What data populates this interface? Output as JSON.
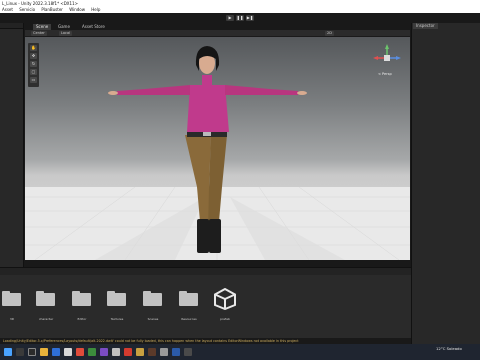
{
  "window": {
    "title": "L_Linux - Unity 2022.3.18f1* <DX11>"
  },
  "menu": [
    {
      "label": "Asset"
    },
    {
      "label": "Servicio"
    },
    {
      "label": "PlanBuster"
    },
    {
      "label": "Window"
    },
    {
      "label": "Help"
    }
  ],
  "play_controls": {
    "play": "▶",
    "pause": "❚❚",
    "step": "▶❚"
  },
  "scene_tabs": [
    {
      "label": "Scene"
    },
    {
      "label": "Game"
    },
    {
      "label": "Asset Store"
    }
  ],
  "scene_toolbar": {
    "shading": "Center",
    "space": "Local",
    "mode": "2D"
  },
  "gizmo": {
    "label": "< Persp"
  },
  "inspector": {
    "label": "Inspector"
  },
  "assets": [
    {
      "name": "3D"
    },
    {
      "name": "character"
    },
    {
      "name": "Editor"
    },
    {
      "name": "Textures"
    },
    {
      "name": "Scenes"
    },
    {
      "name": "Resources"
    },
    {
      "name": "prefab"
    }
  ],
  "status": {
    "message": "Loading/Unity/Editor-5.x/Preferences/Layouts/default/alt-2022.dwlt' could not be fully loaded, this can happen when the layout contains EditorWindows not available in this project"
  },
  "taskbar": {
    "tray": "12°C  Soleado"
  },
  "colors": {
    "scene_sky_top": "#55585b",
    "floor": "#e9e9e9",
    "shirt": "#c03a8c",
    "pants": "#8a6a3a",
    "taskbar": "#1f2530"
  }
}
